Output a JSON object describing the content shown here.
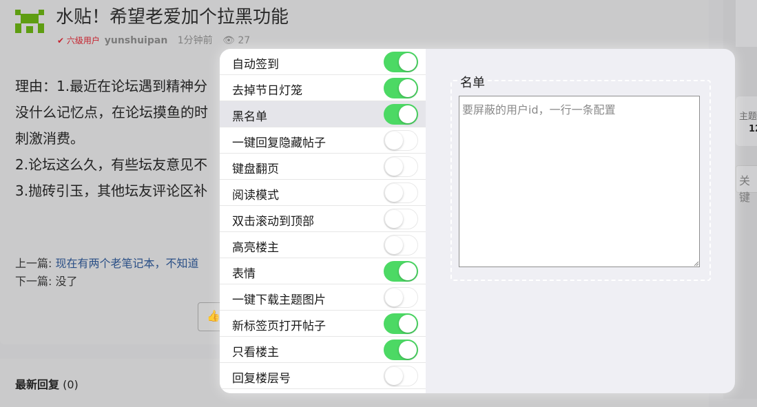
{
  "post": {
    "title": "水贴！希望老爱加个拉黑功能",
    "level_label": "六级用户",
    "username": "yunshuipan",
    "time": "1分钟前",
    "views": "27",
    "body_lines": [
      "理由：1.最近在论坛遇到精神分",
      "没什么记忆点，在论坛摸鱼的时",
      "刺激消费。",
      "2.论坛这么久，有些坛友意见不",
      "3.抛砖引玉，其他坛友评论区补"
    ],
    "prev_label": "上一篇:",
    "prev_link": "现在有两个老笔记本，不知道",
    "next_label": "下一篇:",
    "next_text": "没了",
    "latest_replies_label": "最新回复",
    "latest_replies_count": "(0)"
  },
  "sidebar_right": {
    "stat_label": "主题",
    "stat_value": "12",
    "search_label": "关键"
  },
  "settings": {
    "items": [
      {
        "label": "自动签到",
        "on": true,
        "selected": false
      },
      {
        "label": "去掉节日灯笼",
        "on": true,
        "selected": false
      },
      {
        "label": "黑名单",
        "on": true,
        "selected": true
      },
      {
        "label": "一键回复隐藏帖子",
        "on": false,
        "selected": false
      },
      {
        "label": "键盘翻页",
        "on": false,
        "selected": false
      },
      {
        "label": "阅读模式",
        "on": false,
        "selected": false
      },
      {
        "label": "双击滚动到顶部",
        "on": false,
        "selected": false
      },
      {
        "label": "高亮楼主",
        "on": false,
        "selected": false
      },
      {
        "label": "表情",
        "on": true,
        "selected": false
      },
      {
        "label": "一键下载主题图片",
        "on": false,
        "selected": false
      },
      {
        "label": "新标签页打开帖子",
        "on": true,
        "selected": false
      },
      {
        "label": "只看楼主",
        "on": true,
        "selected": false
      },
      {
        "label": "回复楼层号",
        "on": false,
        "selected": false
      }
    ],
    "panel": {
      "legend": "名单",
      "textarea_value": "",
      "textarea_placeholder": "要屏蔽的用户id，一行一条配置"
    }
  },
  "colors": {
    "toggle_on": "#4cd964",
    "level_red": "#c5212d",
    "logo_green": "#5e9d12",
    "link_blue": "#2a4f86"
  }
}
